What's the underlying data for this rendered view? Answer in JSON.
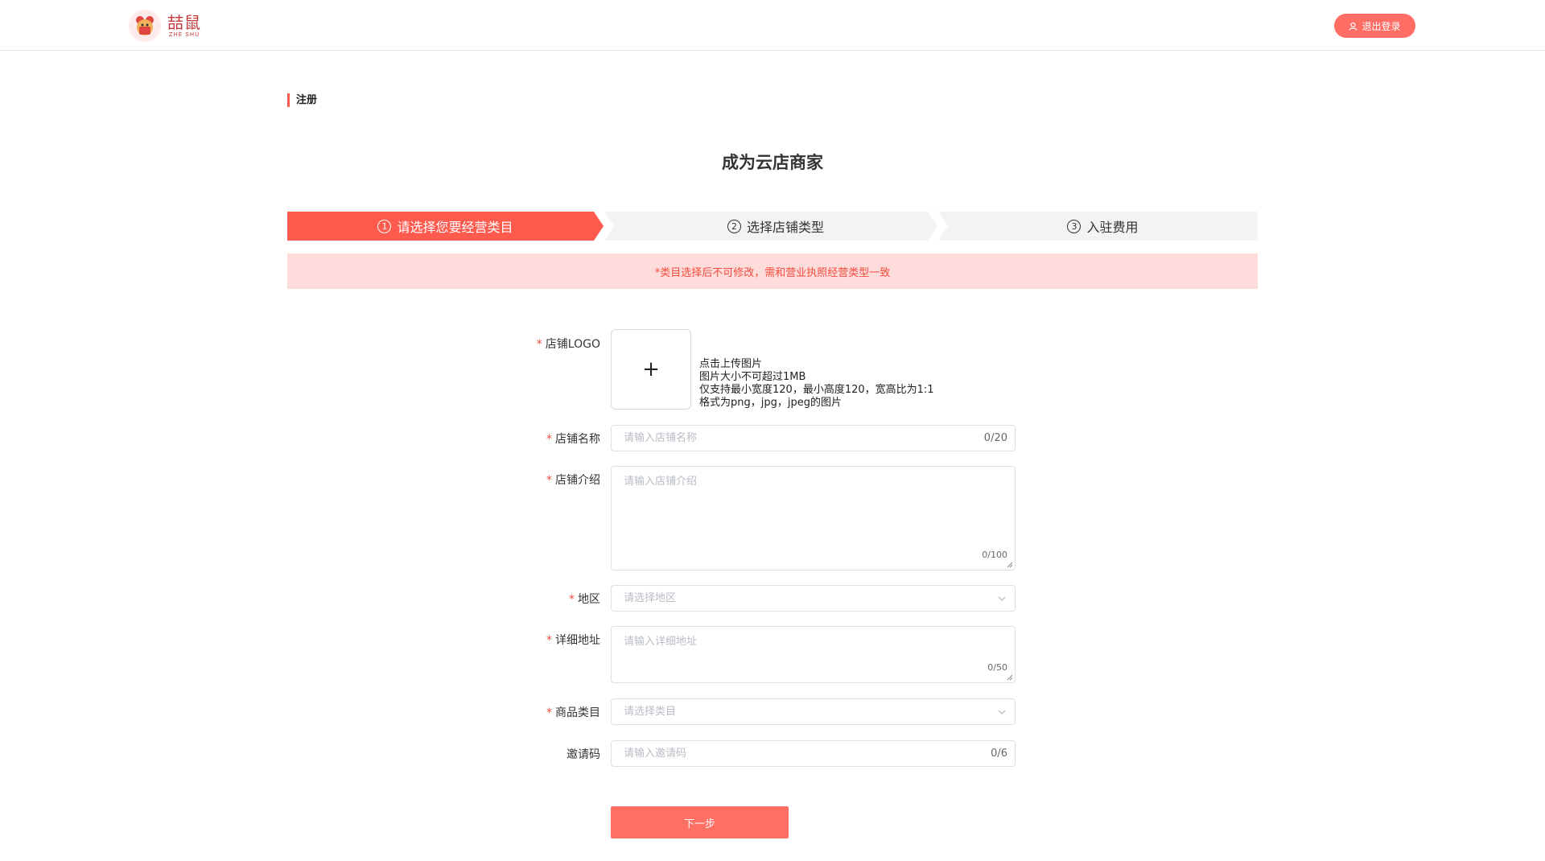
{
  "header": {
    "logo_cn": "喆鼠",
    "logo_en": "ZHE SHU",
    "logout_label": "退出登录"
  },
  "section": {
    "title": "注册"
  },
  "page": {
    "title": "成为云店商家"
  },
  "steps": [
    {
      "num": "1",
      "label": "请选择您要经营类目",
      "active": true
    },
    {
      "num": "2",
      "label": "选择店铺类型",
      "active": false
    },
    {
      "num": "3",
      "label": "入驻费用",
      "active": false
    }
  ],
  "notice": "*类目选择后不可修改，需和营业执照经营类型一致",
  "form": {
    "logo": {
      "label": "店铺LOGO",
      "plus": "+",
      "tips": [
        "点击上传图片",
        "图片大小不可超过1MB",
        "仅支持最小宽度120，最小高度120，宽高比为1:1",
        "格式为png，jpg，jpeg的图片"
      ]
    },
    "shop_name": {
      "label": "店铺名称",
      "placeholder": "请输入店铺名称",
      "count": "0/20"
    },
    "shop_intro": {
      "label": "店铺介绍",
      "placeholder": "请输入店铺介绍",
      "count": "0/100"
    },
    "region": {
      "label": "地区",
      "placeholder": "请选择地区"
    },
    "address": {
      "label": "详细地址",
      "placeholder": "请输入详细地址",
      "count": "0/50"
    },
    "category": {
      "label": "商品类目",
      "placeholder": "请选择类目"
    },
    "invite": {
      "label": "邀请码",
      "placeholder": "请输入邀请码",
      "count": "0/6"
    },
    "required_mark": "*",
    "next_label": "下一步"
  },
  "colors": {
    "accent": "#ff5a4e",
    "button": "#ff6f64",
    "notice_bg": "#ffdcdc",
    "notice_text": "#f34b3d"
  }
}
